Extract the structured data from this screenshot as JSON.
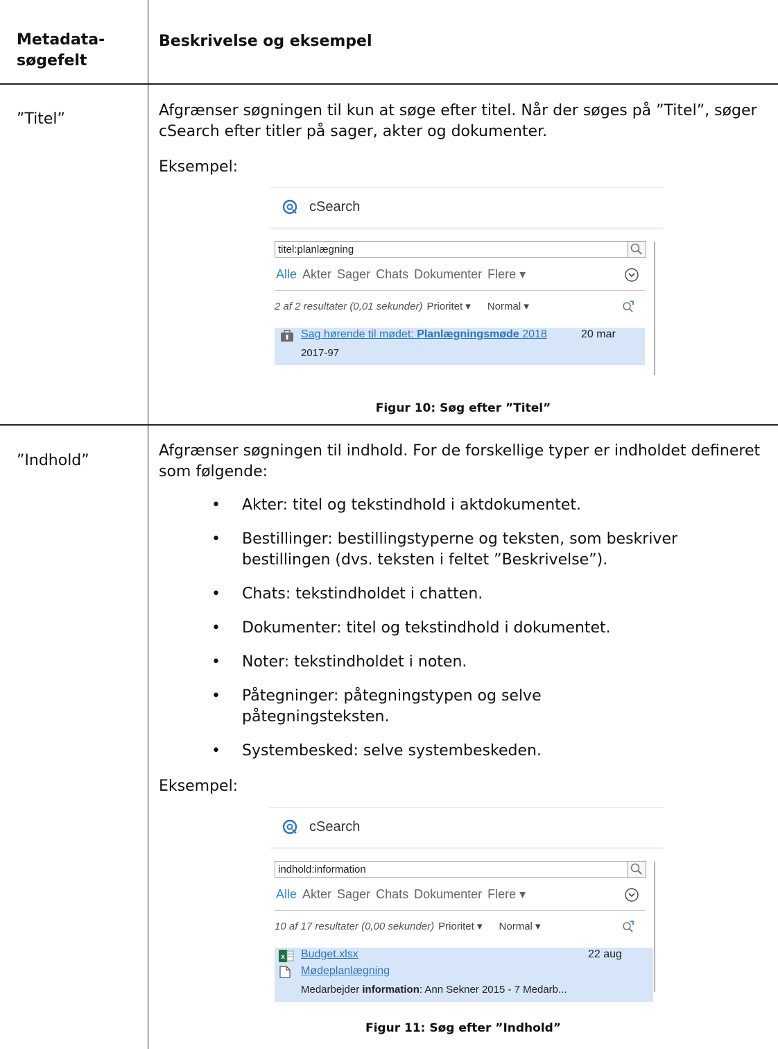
{
  "header": {
    "col1": [
      "Metadata-",
      "søgefelt"
    ],
    "col2": "Beskrivelse og eksempel"
  },
  "row1": {
    "field": "”Titel”",
    "description": "Afgrænser søgningen til kun at søge efter titel. Når der søges på ”Titel”, søger cSearch efter titler på sager, akter og dokumenter.",
    "example_label": "Eksempel:",
    "caption": "Figur 10: Søg efter ”Titel”",
    "screenshot": {
      "app_title": "cSearch",
      "query": "titel:planlægning",
      "tabs": [
        "Alle",
        "Akter",
        "Sager",
        "Chats",
        "Dokumenter",
        "Flere ▾"
      ],
      "status": "2 af 2 resultater (0,01 sekunder)",
      "priority": "Prioritet ▾",
      "normal": "Normal ▾",
      "result": {
        "title_prefix": "Sag hørende til mødet: ",
        "title_bold": "Planlægningsmøde",
        "title_suffix": " 2018",
        "date": "20 mar",
        "sub": "2017-97"
      }
    }
  },
  "row2": {
    "field": "”Indhold”",
    "description": "Afgrænser søgningen til indhold. For de forskellige typer er indholdet defineret som følgende:",
    "bullets": [
      "Akter: titel og tekstindhold i aktdokumentet.",
      "Bestillinger: bestillingstyperne og teksten, som beskriver bestillingen (dvs. teksten i feltet ”Beskrivelse”).",
      "Chats: tekstindholdet i chatten.",
      "Dokumenter: titel og tekstindhold i dokumentet.",
      "Noter: tekstindholdet i noten.",
      "Påtegninger: påtegningstypen og selve påtegningsteksten.",
      "Systembesked: selve systembeskeden."
    ],
    "example_label": "Eksempel:",
    "caption": "Figur 11: Søg efter ”Indhold”",
    "screenshot": {
      "app_title": "cSearch",
      "query": "indhold:information",
      "tabs": [
        "Alle",
        "Akter",
        "Sager",
        "Chats",
        "Dokumenter",
        "Flere ▾"
      ],
      "status": "10 af 17 resultater (0,00 sekunder)",
      "priority": "Prioritet ▾",
      "normal": "Normal ▾",
      "result": {
        "file": "Budget.xlsx",
        "date": "22 aug",
        "doc": "Mødeplanlægning",
        "sub_prefix": "Medarbejder ",
        "sub_bold": "information",
        "sub_suffix": ": Ann Sekner 2015 - 7 Medarb..."
      }
    }
  },
  "colors": {
    "accent": "#2a86d6",
    "selected_row": "#d6e6f8",
    "link": "#2a74c6",
    "excel": "#1e7145"
  },
  "icons": [
    "csearch-logo-icon",
    "search-icon",
    "chevron-down-circle-icon",
    "refresh-search-icon",
    "case-icon",
    "excel-icon",
    "document-icon"
  ]
}
